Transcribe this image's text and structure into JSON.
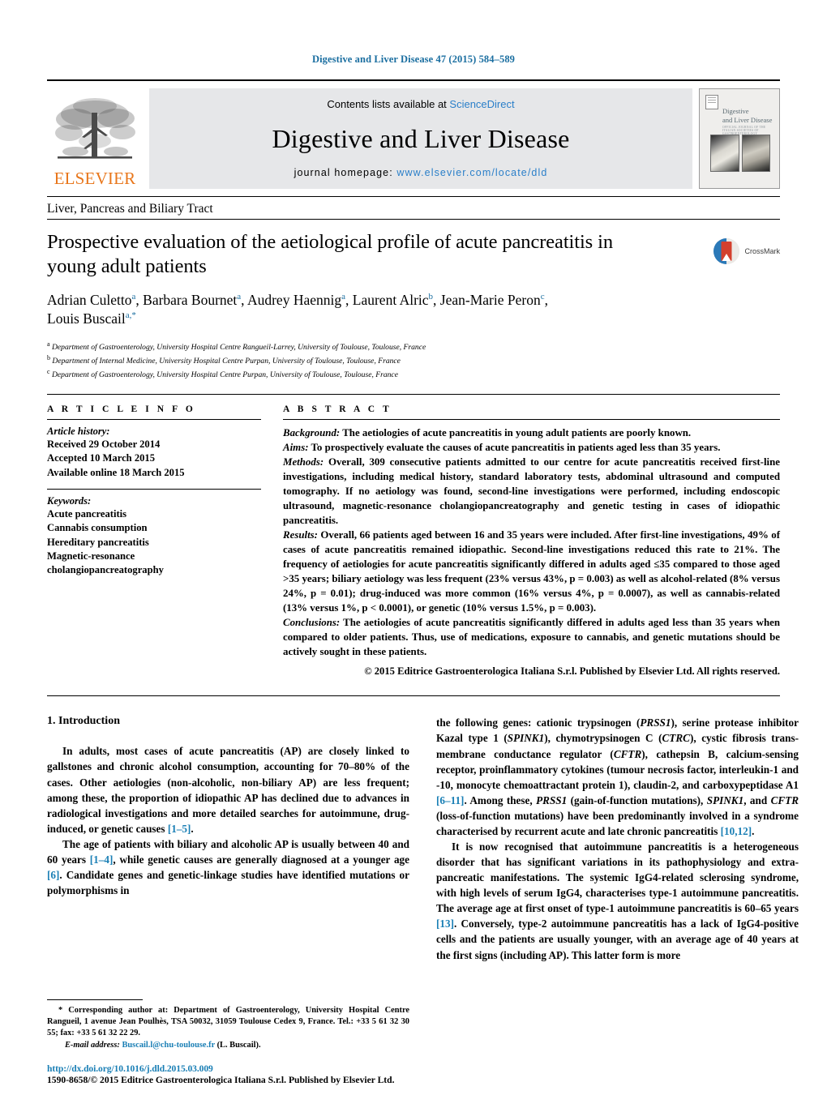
{
  "running_head": "Digestive and Liver Disease 47 (2015) 584–589",
  "masthead": {
    "contents_prefix": "Contents lists available at ",
    "sciencedirect": "ScienceDirect",
    "journal_title": "Digestive and Liver Disease",
    "homepage_prefix": "journal homepage: ",
    "homepage_url": "www.elsevier.com/locate/dld",
    "publisher": "ELSEVIER",
    "cover": {
      "line1": "Digestive",
      "line2": "and Liver Disease",
      "line3": "OFFICIAL JOURNAL OF THE ITALIAN SOCIETIES OF GASTROENTEROLOGY"
    }
  },
  "section_label": "Liver, Pancreas and Biliary Tract",
  "title": "Prospective evaluation of the aetiological profile of acute pancreatitis in young adult patients",
  "crossmark_label": "CrossMark",
  "authors": [
    {
      "name": "Adrian Culetto",
      "sup": "a",
      "sep": ", "
    },
    {
      "name": "Barbara Bournet",
      "sup": "a",
      "sep": ", "
    },
    {
      "name": "Audrey Haennig",
      "sup": "a",
      "sep": ", "
    },
    {
      "name": "Laurent Alric",
      "sup": "b",
      "sep": ", "
    },
    {
      "name": "Jean-Marie Peron",
      "sup": "c",
      "sep": ", "
    },
    {
      "name": "Louis Buscail",
      "sup": "a,",
      "sep": ""
    }
  ],
  "affiliations": [
    {
      "mark": "a",
      "text": "Department of Gastroenterology, University Hospital Centre Rangueil-Larrey, University of Toulouse, Toulouse, France"
    },
    {
      "mark": "b",
      "text": "Department of Internal Medicine, University Hospital Centre Purpan, University of Toulouse, Toulouse, France"
    },
    {
      "mark": "c",
      "text": "Department of Gastroenterology, University Hospital Centre Purpan, University of Toulouse, Toulouse, France"
    }
  ],
  "article_info": {
    "heading": "A R T I C L E    I N F O",
    "history_title": "Article history:",
    "history": [
      "Received 29 October 2014",
      "Accepted 10 March 2015",
      "Available online 18 March 2015"
    ],
    "keywords_title": "Keywords:",
    "keywords": [
      "Acute pancreatitis",
      "Cannabis consumption",
      "Hereditary pancreatitis",
      "Magnetic-resonance",
      "cholangiopancreatography"
    ]
  },
  "abstract": {
    "heading": "A B S T R A C T",
    "background_label": "Background:",
    "background": " The aetiologies of acute pancreatitis in young adult patients are poorly known.",
    "aims_label": "Aims:",
    "aims": " To prospectively evaluate the causes of acute pancreatitis in patients aged less than 35 years.",
    "methods_label": "Methods:",
    "methods": " Overall, 309 consecutive patients admitted to our centre for acute pancreatitis received first-line investigations, including medical history, standard laboratory tests, abdominal ultrasound and computed tomography. If no aetiology was found, second-line investigations were performed, including endoscopic ultrasound, magnetic-resonance cholangiopancreatography and genetic testing in cases of idiopathic pancreatitis.",
    "results_label": "Results:",
    "results": " Overall, 66 patients aged between 16 and 35 years were included. After first-line investigations, 49% of cases of acute pancreatitis remained idiopathic. Second-line investigations reduced this rate to 21%. The frequency of aetiologies for acute pancreatitis significantly differed in adults aged ≤35 compared to those aged >35 years; biliary aetiology was less frequent (23% versus 43%, p = 0.003) as well as alcohol-related (8% versus 24%, p = 0.01); drug-induced was more common (16% versus 4%, p = 0.0007), as well as cannabis-related (13% versus 1%, p < 0.0001), or genetic (10% versus 1.5%, p = 0.003).",
    "conclusions_label": "Conclusions:",
    "conclusions": " The aetiologies of acute pancreatitis significantly differed in adults aged less than 35 years when compared to older patients. Thus, use of medications, exposure to cannabis, and genetic mutations should be actively sought in these patients.",
    "copyright": "© 2015 Editrice Gastroenterologica Italiana S.r.l. Published by Elsevier Ltd. All rights reserved."
  },
  "intro": {
    "heading": "1.  Introduction",
    "p1_a": "In adults, most cases of acute pancreatitis (AP) are closely linked to gallstones and chronic alcohol consumption, accounting for 70–80% of the cases. Other aetiologies (non-alcoholic, non-biliary AP) are less frequent; among these, the proportion of idiopathic AP has declined due to advances in radiological investigations and more detailed searches for autoimmune, drug-induced, or genetic causes ",
    "p1_ref": "[1–5]",
    "p1_b": ".",
    "p2_a": "The age of patients with biliary and alcoholic AP is usually between 40 and 60 years ",
    "p2_ref1": "[1–4]",
    "p2_b": ", while genetic causes are generally diagnosed at a younger age ",
    "p2_ref2": "[6]",
    "p2_c": ". Candidate genes and genetic-linkage studies have identified mutations or polymorphisms in",
    "r1_a": "the following genes: cationic trypsinogen (",
    "r1_g1": "PRSS1",
    "r1_b": "), serine protease inhibitor Kazal type 1 (",
    "r1_g2": "SPINK1",
    "r1_c": "), chymotrypsinogen C (",
    "r1_g3": "CTRC",
    "r1_d": "), cystic fibrosis trans-membrane conductance regulator (",
    "r1_g4": "CFTR",
    "r1_e": "), cathepsin B, calcium-sensing receptor, proinflammatory cytokines (tumour necrosis factor, interleukin-1 and -10, monocyte chemoattractant protein 1), claudin-2, and carboxypeptidase A1 ",
    "r1_ref": "[6–11]",
    "r1_f": ". Among these, ",
    "r1_g5": "PRSS1",
    "r1_g": " (gain-of-function mutations), ",
    "r1_g6": "SPINK1",
    "r1_h": ", and ",
    "r1_g7": "CFTR",
    "r1_i": " (loss-of-function mutations) have been predominantly involved in a syndrome characterised by recurrent acute and late chronic pancreatitis ",
    "r1_ref2": "[10,12]",
    "r1_j": ".",
    "r2_a": "It is now recognised that autoimmune pancreatitis is a heterogeneous disorder that has significant variations in its pathophysiology and extra-pancreatic manifestations. The systemic IgG4-related sclerosing syndrome, with high levels of serum IgG4, characterises type-1 autoimmune pancreatitis. The average age at first onset of type-1 autoimmune pancreatitis is 60–65 years ",
    "r2_ref": "[13]",
    "r2_b": ". Conversely, type-2 autoimmune pancreatitis has a lack of IgG4-positive cells and the patients are usually younger, with an average age of 40 years at the first signs (including AP). This latter form is more"
  },
  "footnote": {
    "star": "*",
    "corresponding": " Corresponding author at: Department of Gastroenterology, University Hospital Centre Rangueil, 1 avenue Jean Poulhès, TSA 50032, 31059 Toulouse Cedex 9, France. Tel.: +33 5 61 32 30 55; fax: +33 5 61 32 22 29.",
    "email_label": "E-mail address:",
    "email": "Buscail.l@chu-toulouse.fr",
    "email_owner": " (L. Buscail)."
  },
  "doi": "http://dx.doi.org/10.1016/j.dld.2015.03.009",
  "issn": "1590-8658/© 2015 Editrice Gastroenterologica Italiana S.r.l. Published by Elsevier Ltd.",
  "colors": {
    "link": "#1a7fb5",
    "header_blue": "#1a6ea0",
    "elsevier_orange": "#e8761b",
    "masthead_gray": "#e6e7e9"
  }
}
